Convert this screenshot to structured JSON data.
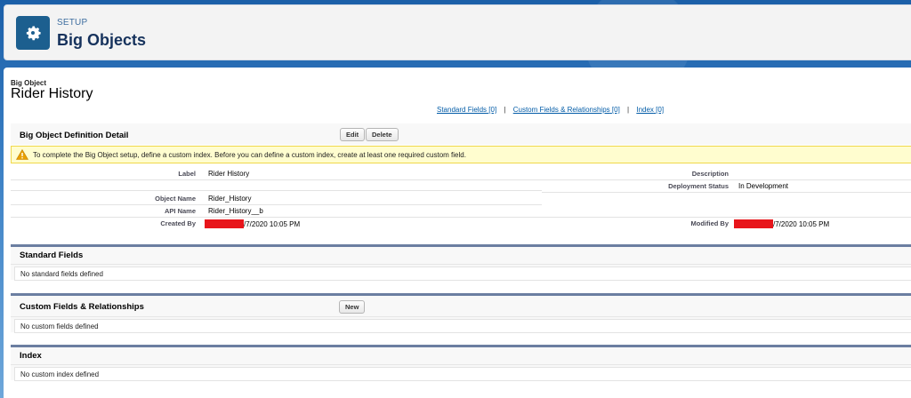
{
  "header": {
    "eyebrow": "SETUP",
    "title": "Big Objects",
    "icon": "gear-icon",
    "icon_bg": "#1c5f8f"
  },
  "record": {
    "type_label": "Big Object",
    "name": "Rider History"
  },
  "related_links": [
    {
      "label": "Standard Fields",
      "count": "[0]"
    },
    {
      "label": "Custom Fields & Relationships",
      "count": "[0]"
    },
    {
      "label": "Index",
      "count": "[0]"
    }
  ],
  "detail": {
    "title": "Big Object Definition Detail",
    "edit_label": "Edit",
    "delete_label": "Delete",
    "warning": "To complete the Big Object setup, define a custom index. Before you can define a custom index, create at least one required custom field.",
    "fields": {
      "label_label": "Label",
      "label_value": "Rider History",
      "description_label": "Description",
      "description_value": "",
      "deployment_label": "Deployment Status",
      "deployment_value": "In Development",
      "object_name_label": "Object Name",
      "object_name_value": "Rider_History",
      "api_name_label": "API Name",
      "api_name_value": "Rider_History__b",
      "created_by_label": "Created By",
      "created_by_value": "/7/2020 10:05 PM",
      "modified_by_label": "Modified By",
      "modified_by_value": "/7/2020 10:05 PM"
    }
  },
  "sections": {
    "standard": {
      "title": "Standard Fields",
      "empty": "No standard fields defined"
    },
    "custom": {
      "title": "Custom Fields & Relationships",
      "new_label": "New",
      "empty": "No custom fields defined"
    },
    "index": {
      "title": "Index",
      "empty": "No custom index defined"
    }
  },
  "colors": {
    "redaction": "#e8151b",
    "warning_bg": "#fffdcf",
    "link": "#015ba7"
  }
}
